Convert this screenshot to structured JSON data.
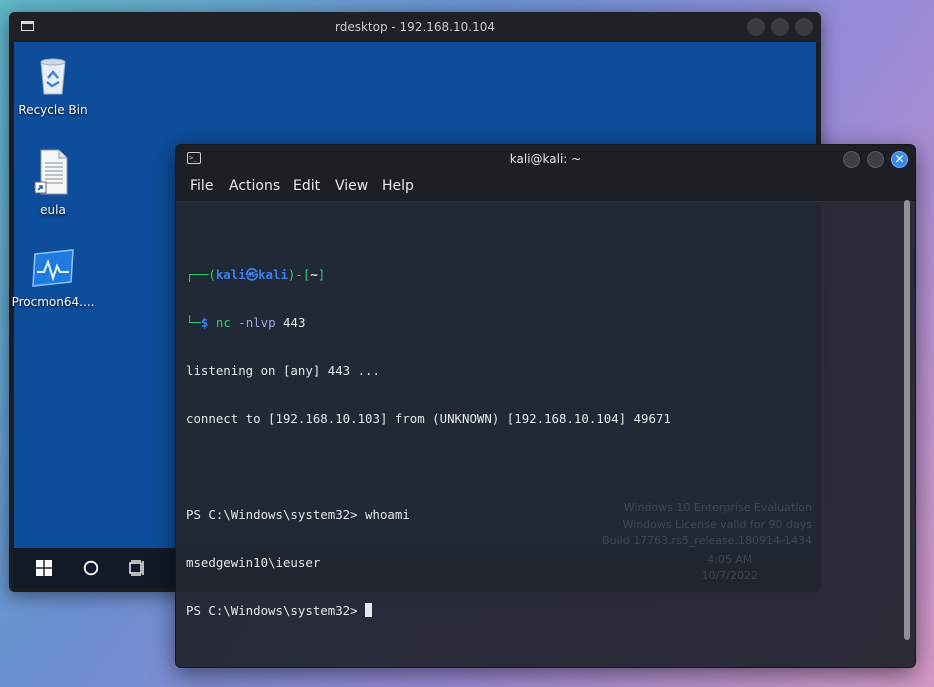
{
  "rdesktop": {
    "title": "rdesktop - 192.168.10.104",
    "desktop_icons": [
      {
        "label": "Recycle Bin",
        "icon": "recycle-bin-icon"
      },
      {
        "label": "eula",
        "icon": "text-file-shortcut-icon"
      },
      {
        "label": "Procmon64....",
        "icon": "procmon-icon"
      }
    ],
    "taskbar": {
      "items": [
        "windows-start-icon",
        "cortana-circle-icon",
        "task-view-icon"
      ]
    },
    "watermark": {
      "line1": "Windows 10 Enterprise Evaluation",
      "line2": "Windows License valid for 90 days",
      "line3": "Build 17763.rs5_release.180914-1434"
    },
    "clock": {
      "time": "4:05 AM",
      "date": "10/7/2022"
    }
  },
  "terminal": {
    "title": "kali@kali: ~",
    "menu": [
      "File",
      "Actions",
      "Edit",
      "View",
      "Help"
    ],
    "prompt": {
      "corner_top": "┌──(",
      "user": "kali",
      "at_symbol": "㉿",
      "host": "kali",
      "mid": ")-[",
      "path": "~",
      "end": "]",
      "corner_bottom": "└─",
      "dollar": "$"
    },
    "command": {
      "name": "nc",
      "args": "-nlvp",
      "port": "443"
    },
    "output": [
      "listening on [any] 443 ...",
      "connect to [192.168.10.103] from (UNKNOWN) [192.168.10.104] 49671",
      "",
      "PS C:\\Windows\\system32> whoami",
      "msedgewin10\\ieuser",
      "PS C:\\Windows\\system32> "
    ]
  },
  "colors": {
    "kali_blue": "#3b7fe8",
    "win_desktop": "#0d4d9c",
    "terminal_bg": "#23262f",
    "close_btn": "#3a8be8"
  }
}
